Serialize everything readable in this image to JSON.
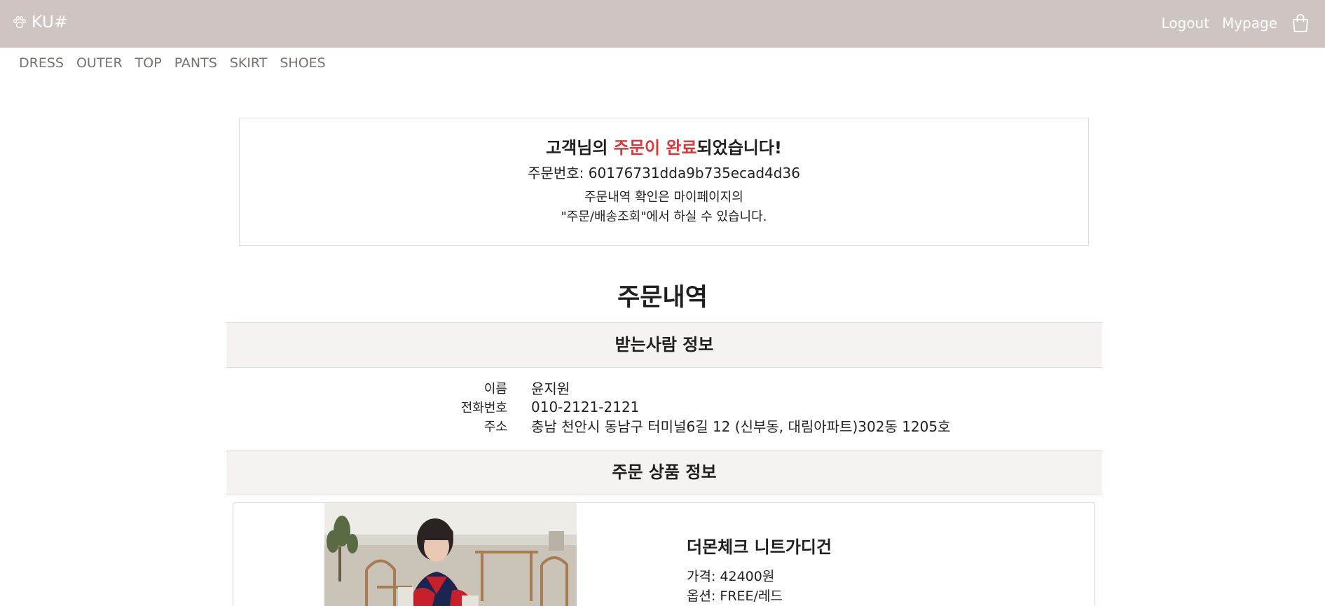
{
  "header": {
    "brand": "KU#",
    "brand_icon": "paw-icon",
    "logout": "Logout",
    "mypage": "Mypage",
    "cart_icon": "shopping-bag-icon",
    "bg_color": "#cec5c3"
  },
  "categories": [
    "DRESS",
    "OUTER",
    "TOP",
    "PANTS",
    "SKIRT",
    "SHOES"
  ],
  "confirmation": {
    "title_prefix": "고객님의 ",
    "title_highlight": "주문이 완료",
    "title_suffix": "되었습니다!",
    "order_number": "주문번호: 60176731dda9b735ecad4d36",
    "note_line1": "주문내역 확인은 마이페이지의",
    "note_line2": "\"주문/배송조회\"에서 하실 수 있습니다.",
    "highlight_color": "#d9383b"
  },
  "order": {
    "title": "주문내역",
    "recipient_heading": "받는사람 정보",
    "recipient": {
      "name_label": "이름",
      "name": "윤지원",
      "phone_label": "전화번호",
      "phone": "010-2121-2121",
      "address_label": "주소",
      "address": "충남 천안시 동남구 터미널6길 12 (신부동, 대림아파트)302동 1205호"
    },
    "product_heading": "주문 상품 정보",
    "product": {
      "name": "더몬체크 니트가디건",
      "price": "가격: 42400원",
      "option": "옵션: FREE/레드"
    }
  }
}
